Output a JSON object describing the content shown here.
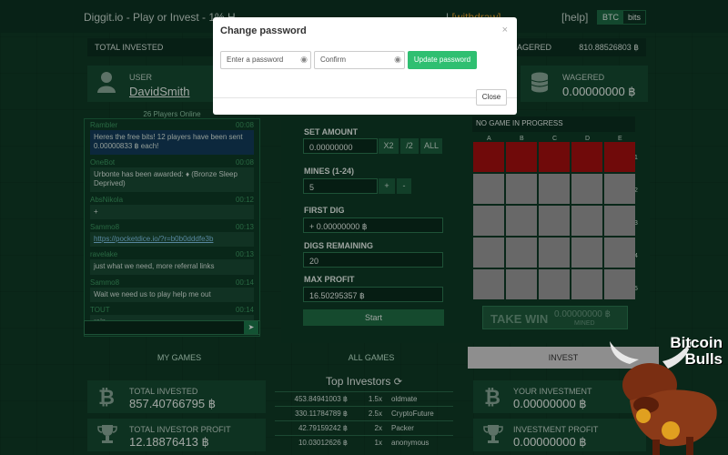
{
  "topbar": {
    "logo": "Diggit.io - Play or Invest - 1% H",
    "links": "| ",
    "withdraw": "[withdraw]",
    "help": "[help]",
    "currencies": [
      "BTC",
      "bits"
    ]
  },
  "stats": {
    "total_invested_label": "TOTAL INVESTED",
    "wagered_label": "AGERED",
    "wagered_value": "810.88526803 ฿"
  },
  "user": {
    "label": "USER",
    "name": "DavidSmith",
    "wagered_label": "WAGERED",
    "wagered_value": "0.00000000 ฿"
  },
  "chat": {
    "online": "26 Players Online",
    "messages": [
      {
        "name": "Rambler",
        "time": "00:08",
        "text": "Heres the free bits! 12 players have been sent 0.00000833 ฿ each!",
        "hl": true
      },
      {
        "name": "OneBot",
        "time": "00:08",
        "text": "Urbonte has been awarded: ♦ (Bronze Sleep Deprived)"
      },
      {
        "name": "AbsNikola",
        "time": "00:12",
        "text": "+"
      },
      {
        "name": "Sammo8",
        "time": "00:13",
        "text": "https://pocketdice.io/?r=b0b0dddfe3b",
        "link": true
      },
      {
        "name": "ravelake",
        "time": "00:13",
        "text": "just what we need, more referral links"
      },
      {
        "name": "Sammo8",
        "time": "00:14",
        "text": "Wait we need us to play help me out"
      },
      {
        "name": "TOUT",
        "time": "00:14",
        "text": "rain"
      }
    ]
  },
  "game": {
    "set_amount_label": "SET AMOUNT",
    "amount_value": "0.00000000",
    "x2": "X2",
    "half": "/2",
    "all": "ALL",
    "mines_label": "MINES (1-24)",
    "mines_value": "5",
    "plus": "+",
    "minus": "-",
    "first_dig_label": "FIRST DIG",
    "first_dig_value": "+ 0.00000000 ฿",
    "digs_remaining_label": "DIGS REMAINING",
    "digs_remaining_value": "20",
    "max_profit_label": "MAX PROFIT",
    "max_profit_value": "16.50295357 ฿",
    "start_label": "Start",
    "status": "NO GAME IN PROGRESS",
    "columns": [
      "A",
      "B",
      "C",
      "D",
      "E"
    ],
    "rows": [
      "1",
      "2",
      "3",
      "4",
      "5"
    ],
    "take_win_label": "TAKE WIN",
    "take_win_value": "0.00000000 ฿",
    "mined_label": "MINED"
  },
  "tabs": [
    "MY GAMES",
    "ALL GAMES",
    "INVEST"
  ],
  "bottom": {
    "total_invested_label": "TOTAL INVESTED",
    "total_invested_value": "857.40766795 ฿",
    "total_profit_label": "TOTAL INVESTOR PROFIT",
    "total_profit_value": "12.18876413 ฿",
    "your_investment_label": "YOUR INVESTMENT",
    "your_investment_value": "0.00000000 ฿",
    "investment_profit_label": "INVESTMENT PROFIT",
    "investment_profit_value": "0.00000000 ฿"
  },
  "investors": {
    "title": "Top Investors",
    "rows": [
      [
        "453.84941003 ฿",
        "1.5x",
        "oldmate"
      ],
      [
        "330.11784789 ฿",
        "2.5x",
        "CryptoFuture"
      ],
      [
        "42.79159242 ฿",
        "2x",
        "Packer"
      ],
      [
        "10.03012626 ฿",
        "1x",
        "anonymous"
      ]
    ]
  },
  "modal": {
    "title": "Change password",
    "close_x": "×",
    "password_placeholder": "Enter a password",
    "confirm_placeholder": "Confirm",
    "update_label": "Update password",
    "close_label": "Close"
  },
  "watermark": {
    "line1": "Bitcoin",
    "line2": "Bulls"
  },
  "colors": {
    "background": "#0f3a26",
    "accent_green": "#2fbf71",
    "mine_red": "#a50f0f"
  }
}
